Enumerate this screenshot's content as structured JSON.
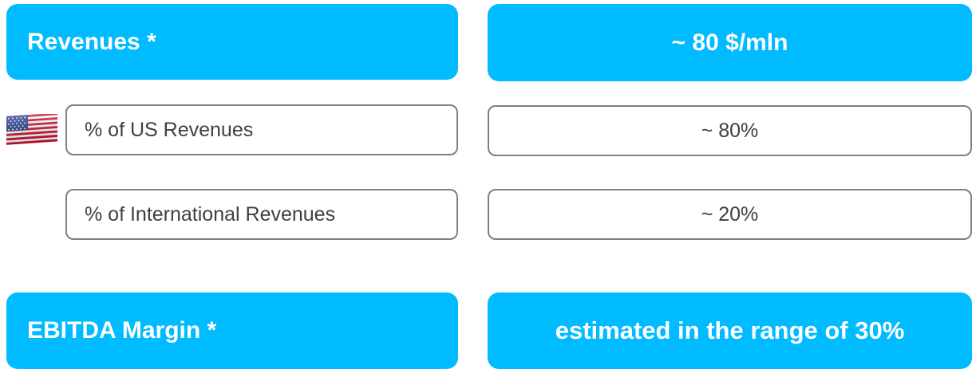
{
  "revenues": {
    "label": "Revenues *",
    "value": "~ 80 $/mln"
  },
  "us_revenues": {
    "label": "% of US Revenues",
    "value": "~ 80%",
    "icon": "us-flag-icon"
  },
  "international_revenues": {
    "label": "% of International Revenues",
    "value": "~ 20%"
  },
  "ebitda_margin": {
    "label": "EBITDA Margin *",
    "value": "estimated in the range of 30%"
  },
  "colors": {
    "accent_fill": "#00bbff",
    "outline_border": "#7f7f7f",
    "outline_text": "#404040"
  }
}
